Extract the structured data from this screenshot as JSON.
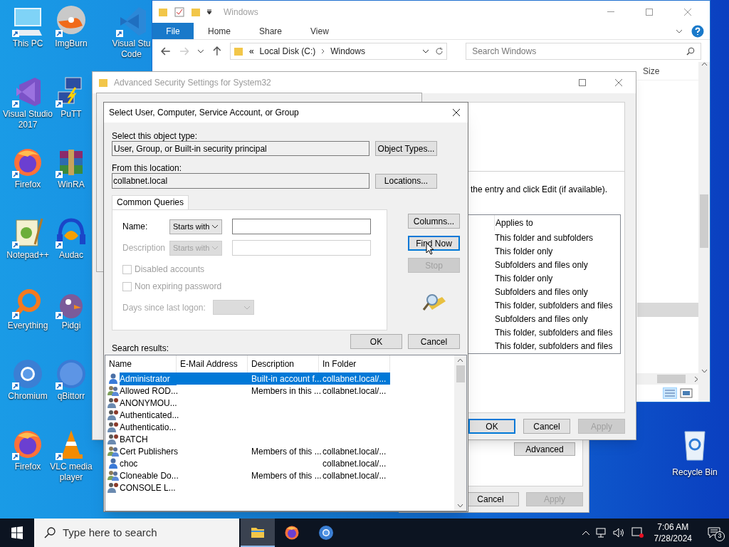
{
  "desktop_icons": [
    {
      "label": "This PC",
      "kind": "pc"
    },
    {
      "label": "Visual Studio\n2017",
      "kind": "vs"
    },
    {
      "label": "Firefox",
      "kind": "firefox"
    },
    {
      "label": "Notepad++",
      "kind": "notepad"
    },
    {
      "label": "Everything",
      "kind": "everything"
    },
    {
      "label": "Chromium",
      "kind": "chromium"
    },
    {
      "label": "Firefox",
      "kind": "firefox"
    },
    {
      "label": "ImgBurn",
      "kind": "disc"
    },
    {
      "label": "PuTT",
      "kind": "putty"
    },
    {
      "label": "WinRA",
      "kind": "winrar"
    },
    {
      "label": "Audac",
      "kind": "audio"
    },
    {
      "label": "Pidgi",
      "kind": "pidgin"
    },
    {
      "label": "qBittorr",
      "kind": "qbit"
    },
    {
      "label": "VLC media\nplayer",
      "kind": "vlc"
    },
    {
      "label": "Visual Stu\nCode",
      "kind": "vscode"
    }
  ],
  "recycle_bin": {
    "label": "Recycle Bin"
  },
  "explorer": {
    "title": "Windows",
    "ribbon_tabs": [
      {
        "label": "File",
        "selected": true
      },
      {
        "label": "Home",
        "selected": false
      },
      {
        "label": "Share",
        "selected": false
      },
      {
        "label": "View",
        "selected": false
      }
    ],
    "address": {
      "prefix": "«",
      "parts": [
        "Local Disk (C:)",
        "Windows"
      ]
    },
    "search": {
      "placeholder": "Search Windows"
    },
    "column_header": "Size"
  },
  "advanced_security": {
    "title": "Advanced Security Settings for System32",
    "instruction": "the entry and click Edit (if available).",
    "applies_header": "Applies to",
    "applies_rows": [
      "This folder and subfolders",
      "This folder only",
      "Subfolders and files only",
      "This folder only",
      "Subfolders and files only",
      "This folder, subfolders and files",
      "Subfolders and files only",
      "This folder, subfolders and files",
      "This folder, subfolders and files"
    ],
    "buttons": [
      {
        "label": "OK",
        "focused": true,
        "disabled": false
      },
      {
        "label": "Cancel",
        "focused": false,
        "disabled": false
      },
      {
        "label": "Apply",
        "focused": false,
        "disabled": true
      }
    ]
  },
  "properties_window": {
    "advanced_button": "Advanced",
    "buttons": [
      {
        "label": "Cancel",
        "disabled": false
      },
      {
        "label": "Apply",
        "disabled": true
      }
    ]
  },
  "dialog": {
    "title": "Select User, Computer, Service Account, or Group",
    "object_type_label": "Select this object type:",
    "object_type": "User, Group, or Built-in security principal",
    "object_types_button": "Object Types...",
    "location_label": "From this location:",
    "location": "collabnet.local",
    "locations_button": "Locations...",
    "tab": "Common Queries",
    "name_label": "Name:",
    "name_match": "Starts with",
    "description_label": "Description",
    "description_match": "Starts with",
    "description_disabled": true,
    "checkboxes": [
      {
        "label": "Disabled accounts",
        "checked": false,
        "disabled": true
      },
      {
        "label": "Non expiring password",
        "checked": false,
        "disabled": true
      }
    ],
    "days_label": "Days since last logon:",
    "side_buttons": [
      {
        "label": "Columns...",
        "focused": false,
        "disabled": false
      },
      {
        "label": "Find Now",
        "focused": true,
        "disabled": false
      },
      {
        "label": "Stop",
        "focused": false,
        "disabled": true
      }
    ],
    "ok_button": "OK",
    "cancel_button": "Cancel",
    "results_label": "Search results:",
    "columns": [
      "Name",
      "E-Mail Address",
      "Description",
      "In Folder"
    ],
    "rows": [
      {
        "name": "Administrator",
        "kind": "user",
        "description": "Built-in account f...",
        "folder": "collabnet.local/...",
        "selected": true
      },
      {
        "name": "Allowed ROD...",
        "kind": "group",
        "description": "Members in this ...",
        "folder": "collabnet.local/...",
        "selected": false
      },
      {
        "name": "ANONYMOU...",
        "kind": "special",
        "selected": false
      },
      {
        "name": "Authenticated...",
        "kind": "special",
        "selected": false
      },
      {
        "name": "Authenticatio...",
        "kind": "special",
        "selected": false
      },
      {
        "name": "BATCH",
        "kind": "special",
        "selected": false
      },
      {
        "name": "Cert Publishers",
        "kind": "group",
        "description": "Members of this ...",
        "folder": "collabnet.local/...",
        "selected": false
      },
      {
        "name": "choc",
        "kind": "user",
        "folder": "collabnet.local/...",
        "selected": false
      },
      {
        "name": "Cloneable Do...",
        "kind": "group",
        "description": "Members of this ...",
        "folder": "collabnet.local/...",
        "selected": false
      },
      {
        "name": "CONSOLE L...",
        "kind": "special",
        "selected": false
      }
    ]
  },
  "taskbar": {
    "search_placeholder": "Type here to search",
    "apps": [
      {
        "kind": "folder",
        "selected": true
      },
      {
        "kind": "firefox",
        "selected": false
      },
      {
        "kind": "chromium",
        "selected": false
      }
    ],
    "time": "7:06 AM",
    "date": "7/28/2024",
    "notifications": "3"
  }
}
